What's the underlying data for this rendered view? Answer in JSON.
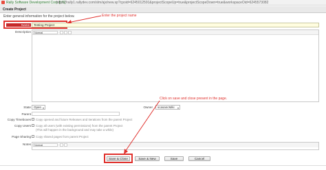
{
  "browser": {
    "cert_label": "Rally Software Development Corp [US]",
    "url": "https://rally1.rallydev.com/slm/ajx/new.sp?cpoid=6245012591&projectScopeUp=true&projectScopeDown=true&workspaceOid=6245573082"
  },
  "dialog": {
    "title": "Create Project",
    "instruction": "Enter general information for the project below."
  },
  "labels": {
    "name": "Name",
    "description": "Description",
    "state": "State",
    "owner": "Owner",
    "parent": "Parent",
    "copy_timeboxes": "Copy Timeboxes",
    "copy_users": "Copy Users",
    "page_sharing": "Page Sharing",
    "notes": "Notes"
  },
  "fields": {
    "name_value": "Testing Project",
    "desc_font": "Normal",
    "notes_font": "Normal",
    "state_value": "Open",
    "owner_value": "scasancMiki"
  },
  "checkboxes": {
    "copy_timeboxes": "Copy opened and future Releases and Iterations from the parent Project",
    "copy_users": "Copy all users (with existing permissions) from the parent Project",
    "copy_users_note": "(This will happen in the background and may take a while)",
    "page_sharing": "Copy shared pages from parent Project"
  },
  "annotations": {
    "enter_name": "Enter the project name",
    "save_close": "Click on save and close present in the page."
  },
  "buttons": {
    "save_close": "Save & Close",
    "save_new": "Save & New",
    "save": "Save",
    "cancel": "Cancel"
  },
  "colors": {
    "annotation_red": "#e0302c",
    "name_input_bg": "#fffde0"
  }
}
